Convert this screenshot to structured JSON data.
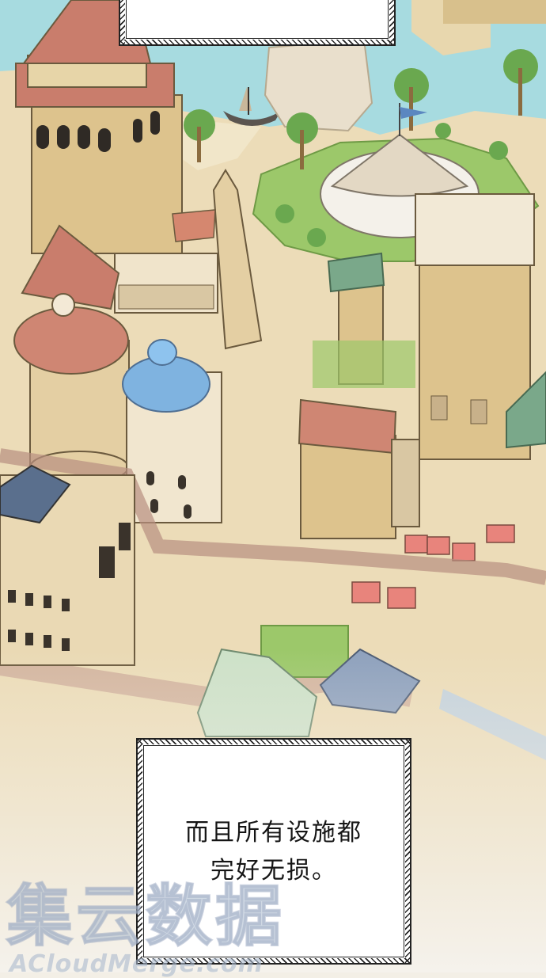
{
  "caption_bottom": {
    "line1": "而且所有设施都",
    "line2": "完好无损。"
  },
  "watermark": {
    "cn": "集云数据",
    "en": "ACloudMerge.com"
  },
  "colors": {
    "sand": "#e6d2a6",
    "stone": "#d8c08c",
    "roof_red": "#c97d6c",
    "dome_blue": "#7fb3e0",
    "water": "#a7dbe0",
    "grass": "#9cc86a",
    "background": "#f3efe6"
  }
}
